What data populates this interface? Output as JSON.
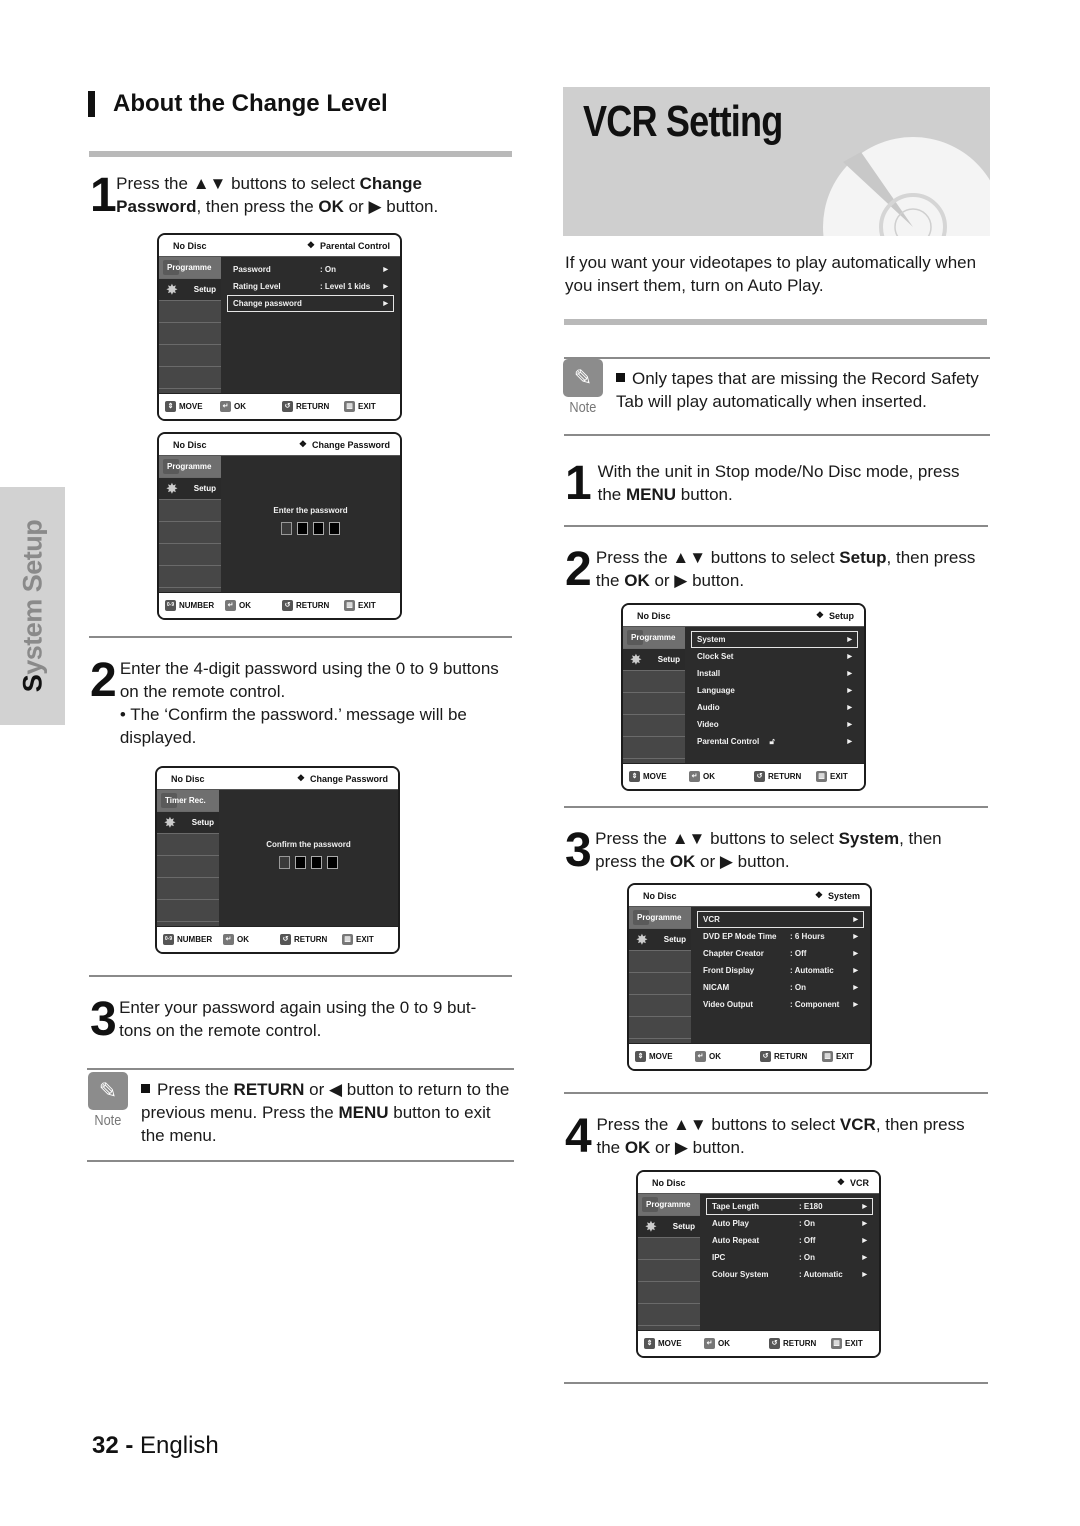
{
  "side_tab": {
    "label_first": "S",
    "label_rest": "ystem Setup"
  },
  "left": {
    "heading": "About the Change Level",
    "step1": {
      "num": "1",
      "parts": [
        "Press the ",
        "▲▼",
        " buttons to select ",
        "Change Password",
        ", then press the ",
        "OK",
        " or ",
        "▶",
        " button."
      ]
    },
    "osd1": {
      "status": "No Disc",
      "title": "Parental Control",
      "tabs": [
        "Programme",
        "Setup"
      ],
      "rows": [
        {
          "key": "Password",
          "value": ": On",
          "arrow": "▶"
        },
        {
          "key": "Rating Level",
          "value": ": Level 1 kids",
          "arrow": "▶"
        },
        {
          "key": "Change password",
          "value": "",
          "arrow": "▶"
        }
      ],
      "footer": [
        "MOVE",
        "OK",
        "RETURN",
        "EXIT"
      ]
    },
    "osd2": {
      "status": "No Disc",
      "title": "Change Password",
      "tabs": [
        "Programme",
        "Setup"
      ],
      "prompt": "Enter the password",
      "footer": [
        "NUMBER",
        "OK",
        "RETURN",
        "EXIT"
      ],
      "number_key": "0-9"
    },
    "step2": {
      "num": "2",
      "text": "Enter the 4-digit password using the 0 to 9 buttons on the remote control.",
      "bullet": "• The ‘Confirm the password.’ message will be displayed."
    },
    "osd3": {
      "status": "No Disc",
      "title": "Change Password",
      "tabs": [
        "Timer Rec.",
        "Setup"
      ],
      "prompt": "Confirm the password",
      "footer": [
        "NUMBER",
        "OK",
        "RETURN",
        "EXIT"
      ],
      "number_key": "0-9"
    },
    "step3": {
      "num": "3",
      "text": "Enter your password again using the 0 to 9 but- tons on the remote control."
    },
    "note": {
      "label": "Note",
      "parts": [
        "Press the ",
        "RETURN",
        " or ◀ button to return to the previous menu. Press the ",
        "MENU",
        " button to exit the menu."
      ]
    }
  },
  "right": {
    "title": "VCR Setting",
    "intro": "If you want your videotapes to play automatically when you insert them, turn on Auto Play.",
    "note": {
      "label": "Note",
      "text": "Only tapes that are missing the Record Safety Tab will play automatically when inserted."
    },
    "step1": {
      "num": "1",
      "parts": [
        "With the unit in Stop mode/No Disc mode, press the ",
        "MENU",
        " button."
      ]
    },
    "step2": {
      "num": "2",
      "parts": [
        "Press the ▲▼ buttons to select ",
        "Setup",
        ", then press the ",
        "OK",
        " or ▶ button."
      ]
    },
    "osd_setup": {
      "status": "No Disc",
      "title": "Setup",
      "tabs": [
        "Programme",
        "Setup"
      ],
      "rows": [
        {
          "key": "System",
          "value": "",
          "arrow": "▶"
        },
        {
          "key": "Clock Set",
          "value": "",
          "arrow": "▶"
        },
        {
          "key": "Install",
          "value": "",
          "arrow": "▶"
        },
        {
          "key": "Language",
          "value": "",
          "arrow": "▶"
        },
        {
          "key": "Audio",
          "value": "",
          "arrow": "▶"
        },
        {
          "key": "Video",
          "value": "",
          "arrow": "▶"
        },
        {
          "key": "Parental Control",
          "value": "",
          "arrow": "▶",
          "lock": true
        }
      ],
      "footer": [
        "MOVE",
        "OK",
        "RETURN",
        "EXIT"
      ]
    },
    "step3": {
      "num": "3",
      "parts": [
        "Press the ▲▼ buttons to select ",
        "System",
        ", then press the ",
        "OK",
        " or ▶ button."
      ]
    },
    "osd_system": {
      "status": "No Disc",
      "title": "System",
      "tabs": [
        "Programme",
        "Setup"
      ],
      "rows": [
        {
          "key": "VCR",
          "value": "",
          "arrow": "▶"
        },
        {
          "key": "DVD EP Mode Time",
          "value": ": 6 Hours",
          "arrow": "▶"
        },
        {
          "key": "Chapter Creator",
          "value": ": Off",
          "arrow": "▶"
        },
        {
          "key": "Front Display",
          "value": ": Automatic",
          "arrow": "▶"
        },
        {
          "key": "NICAM",
          "value": ": On",
          "arrow": "▶"
        },
        {
          "key": "Video Output",
          "value": ": Component",
          "arrow": "▶"
        }
      ],
      "footer": [
        "MOVE",
        "OK",
        "RETURN",
        "EXIT"
      ]
    },
    "step4": {
      "num": "4",
      "parts": [
        "Press the ▲▼ buttons to select ",
        "VCR",
        ", then press the ",
        "OK",
        " or ▶ button."
      ]
    },
    "osd_vcr": {
      "status": "No Disc",
      "title": "VCR",
      "tabs": [
        "Programme",
        "Setup"
      ],
      "rows": [
        {
          "key": "Tape Length",
          "value": ": E180",
          "arrow": "▶"
        },
        {
          "key": "Auto Play",
          "value": ": On",
          "arrow": "▶"
        },
        {
          "key": "Auto Repeat",
          "value": ": Off",
          "arrow": "▶"
        },
        {
          "key": "IPC",
          "value": ": On",
          "arrow": "▶"
        },
        {
          "key": "Colour System",
          "value": ": Automatic",
          "arrow": "▶"
        }
      ],
      "footer": [
        "MOVE",
        "OK",
        "RETURN",
        "EXIT"
      ]
    }
  },
  "footer": {
    "page": "32",
    "sep": " - ",
    "lang": "English"
  }
}
